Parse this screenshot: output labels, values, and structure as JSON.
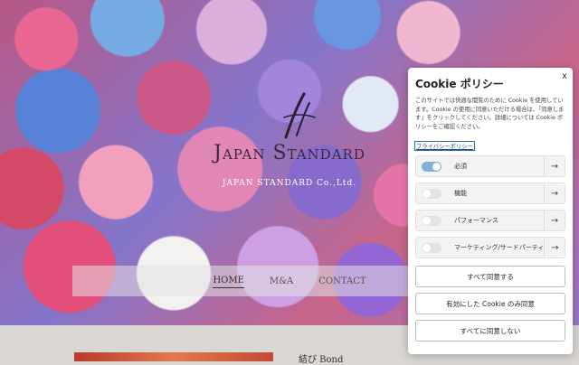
{
  "site": {
    "logo_title": "Japan Standard",
    "logo_subtitle": "JAPAN STANDARD Co.,Ltd."
  },
  "nav": {
    "items": [
      {
        "label": "HOME",
        "active": true
      },
      {
        "label": "M&A",
        "active": false
      },
      {
        "label": "CONTACT",
        "active": false
      }
    ]
  },
  "section": {
    "title": "結び  Bond"
  },
  "cookie": {
    "close_label": "x",
    "title": "Cookie ポリシー",
    "description": "このサイトでは快適な閲覧のために Cookie を使用しています。Cookie の使用に同意いただける場合は、「同意します」をクリックしてください。詳細については Cookie ポリシーをご確認ください。",
    "privacy_link": "プライバシーポリシー",
    "categories": [
      {
        "label": "必須",
        "enabled": true
      },
      {
        "label": "機能",
        "enabled": false
      },
      {
        "label": "パフォーマンス",
        "enabled": false
      },
      {
        "label": "マーケティング/サードパーティ",
        "enabled": false
      }
    ],
    "arrow_glyph": "→",
    "accept_all": "すべて同意する",
    "accept_selected": "有効にした Cookie のみ同意",
    "reject_all": "すべてに同意しない"
  },
  "colors": {
    "toggle_on": "#7db0d8",
    "toggle_off": "#e3e3e3",
    "link": "#1a4a8a"
  }
}
